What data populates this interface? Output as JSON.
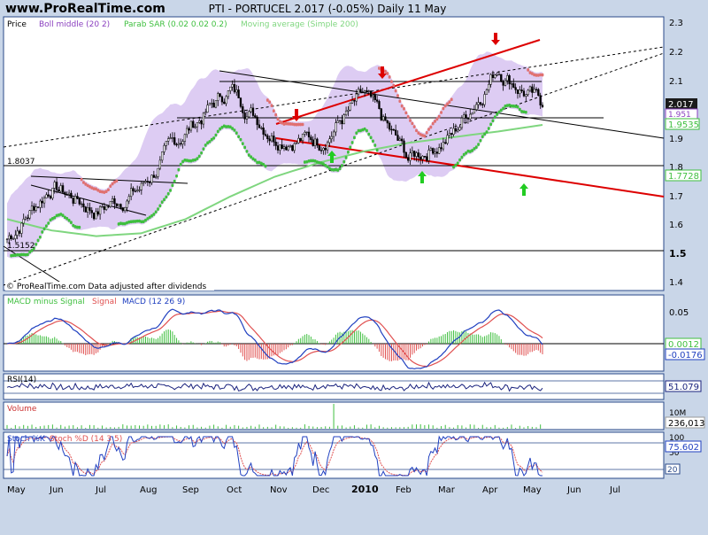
{
  "header": {
    "site": "www.ProRealTime.com",
    "title": "PTI - PORTUCEL    2.017 (-0.05%)    Daily  11 May"
  },
  "price_panel": {
    "legend": [
      {
        "text": "Price",
        "color": "#000000"
      },
      {
        "text": "Boll middle (20 2)",
        "color": "#8a3fbf"
      },
      {
        "text": "Parab SAR (0.02 0.02 0.2)",
        "color": "#3fbf3f"
      },
      {
        "text": "Moving average (Simple 200)",
        "color": "#7fd67f"
      }
    ],
    "footnote": "© ProRealTime.com Data adjusted after dividends",
    "level_labels": [
      "1.8037",
      "1.5152"
    ],
    "y_ticks": [
      "2.3",
      "2.2",
      "2.1",
      "2",
      "1.9",
      "1.8",
      "1.7",
      "1.6",
      "1.5",
      "1.4"
    ],
    "value_boxes": [
      {
        "text": "2.017",
        "bg": "#1a1a1a",
        "fg": "#ffffff",
        "value": 2.017
      },
      {
        "text": "1.951",
        "bg": "#ffffff",
        "fg": "#8a3fbf",
        "value": 1.951
      },
      {
        "text": "1.9535",
        "bg": "#ffffff",
        "fg": "#3fbf3f",
        "value": 1.9535
      },
      {
        "text": "1.7728",
        "bg": "#ffffff",
        "fg": "#3fbf3f",
        "value": 1.7728
      }
    ]
  },
  "macd_panel": {
    "legend": [
      {
        "text": "MACD minus Signal",
        "color": "#3fbf3f"
      },
      {
        "text": "Signal",
        "color": "#e05050"
      },
      {
        "text": "MACD (12 26 9)",
        "color": "#2040c0"
      }
    ],
    "y_ticks": [
      "0.05",
      "0"
    ],
    "value_boxes": [
      {
        "text": "0.0012",
        "color": "#3fbf3f"
      },
      {
        "text": "-0.0176",
        "color": "#2040c0"
      }
    ]
  },
  "rsi_panel": {
    "legend": "RSI(14)",
    "value_box": "51.079"
  },
  "volume_panel": {
    "legend": "Volume",
    "y_tick": "10M",
    "value_box": "236,013"
  },
  "stoch_panel": {
    "legend": [
      {
        "text": "Stoch %K",
        "color": "#2040c0"
      },
      {
        "text": "Stoch %D (14 3 5)",
        "color": "#e05050"
      }
    ],
    "y_ticks": [
      "100",
      "50"
    ],
    "value_boxes": [
      "75.602",
      "20"
    ]
  },
  "x_axis": {
    "labels": [
      "May",
      "Jun",
      "Jul",
      "Aug",
      "Sep",
      "Oct",
      "Nov",
      "Dec",
      "2010",
      "Feb",
      "Mar",
      "Apr",
      "May",
      "Jun",
      "Jul"
    ]
  },
  "colors": {
    "background": "#c9d6e8",
    "panel": "#ffffff",
    "bollinger_fill": "#d9c6f2",
    "sar": "#3fbf3f",
    "ma200": "#7fd67f",
    "channel": "#dd0000",
    "signal_arrow_up": "#22cc22",
    "signal_arrow_down": "#dd0000"
  },
  "chart_data": {
    "type": "candlestick",
    "period": "Daily",
    "x": [
      "2009-05",
      "2009-06",
      "2009-07",
      "2009-08",
      "2009-09",
      "2009-10",
      "2009-11",
      "2009-12",
      "2010-01",
      "2010-02",
      "2010-03",
      "2010-04",
      "2010-05"
    ],
    "close": [
      1.55,
      1.74,
      1.65,
      1.73,
      1.93,
      2.08,
      1.92,
      1.9,
      2.05,
      1.83,
      1.92,
      2.16,
      2.017
    ],
    "ma200": [
      1.62,
      1.58,
      1.56,
      1.57,
      1.62,
      1.7,
      1.77,
      1.82,
      1.86,
      1.89,
      1.91,
      1.93,
      1.9535
    ],
    "horizontal_levels": [
      2.1,
      1.998,
      1.8037,
      1.5152
    ],
    "ylim": [
      1.38,
      2.32
    ],
    "last": 2.017,
    "change_pct": -0.05
  }
}
